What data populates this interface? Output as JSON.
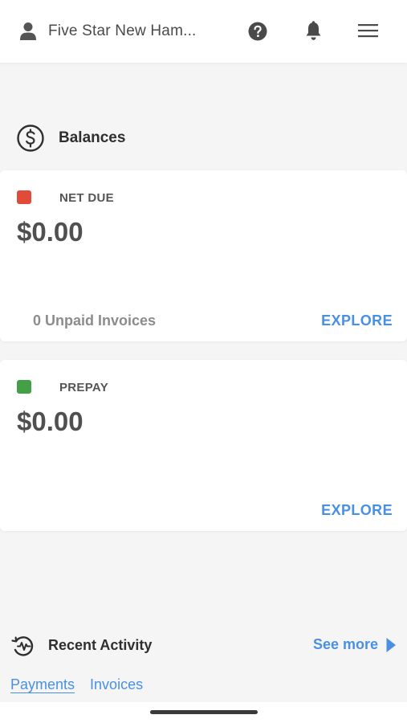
{
  "header": {
    "account_name": "Five Star New Ham...",
    "icons": [
      "user-icon",
      "help-icon",
      "bell-icon",
      "menu-icon"
    ]
  },
  "balances": {
    "title": "Balances",
    "icon": "dollar-circle-icon",
    "net_due": {
      "label": "NET DUE",
      "amount": "$0.00",
      "footer": "0 Unpaid Invoices",
      "action": "EXPLORE",
      "color": "#e04b3a"
    },
    "prepay": {
      "label": "PREPAY",
      "amount": "$0.00",
      "action": "EXPLORE",
      "color": "#43a047"
    }
  },
  "recent_activity": {
    "title": "Recent Activity",
    "icon": "activity-history-icon",
    "see_more": "See more",
    "tabs": [
      {
        "label": "Payments",
        "active": true
      },
      {
        "label": "Invoices",
        "active": false
      }
    ]
  },
  "colors": {
    "accent": "#4a90e2",
    "background": "#f5f5f5"
  }
}
